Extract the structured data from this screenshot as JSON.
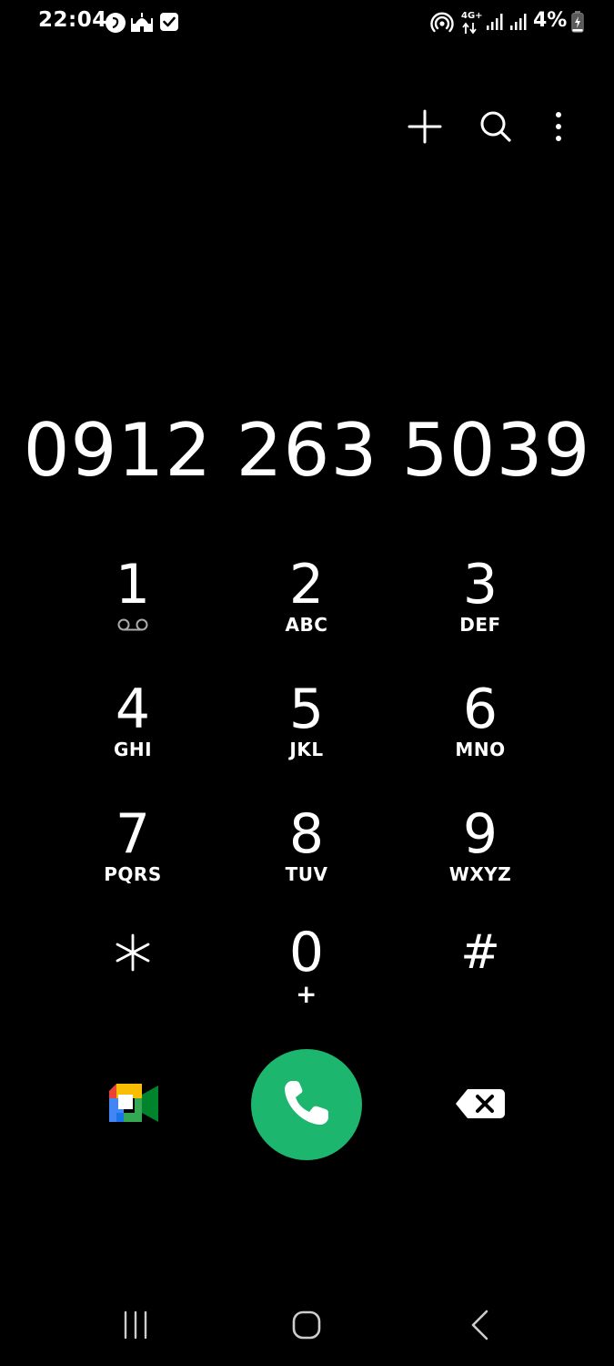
{
  "status_bar": {
    "time": "22:04",
    "network_label": "4G+",
    "battery_percent": "4%",
    "icons": [
      "calling-app-notification-icon",
      "mosque-notification-icon",
      "checkbox-notification-icon",
      "hotspot-icon",
      "network-4g-icon",
      "signal-icon",
      "signal-icon",
      "battery-charging-icon"
    ]
  },
  "toolbar": {
    "icons": [
      "plus-icon",
      "search-icon",
      "more-vertical-icon"
    ]
  },
  "dialer": {
    "number": "0912 263 5039"
  },
  "keypad": {
    "keys": [
      {
        "digit": "1",
        "letters": "",
        "sub_icon": "voicemail-icon"
      },
      {
        "digit": "2",
        "letters": "ABC"
      },
      {
        "digit": "3",
        "letters": "DEF"
      },
      {
        "digit": "4",
        "letters": "GHI"
      },
      {
        "digit": "5",
        "letters": "JKL"
      },
      {
        "digit": "6",
        "letters": "MNO"
      },
      {
        "digit": "7",
        "letters": "PQRS"
      },
      {
        "digit": "8",
        "letters": "TUV"
      },
      {
        "digit": "9",
        "letters": "WXYZ"
      },
      {
        "digit": "*",
        "letters": ""
      },
      {
        "digit": "0",
        "letters": "+"
      },
      {
        "digit": "#",
        "letters": ""
      }
    ]
  },
  "actions": {
    "icons": [
      "google-meet-icon",
      "phone-icon",
      "backspace-icon"
    ]
  },
  "navigation": {
    "icons": [
      "recent-apps-icon",
      "home-icon",
      "back-icon"
    ]
  },
  "colors": {
    "background": "#000000",
    "foreground": "#ffffff",
    "call_button": "#1db66e",
    "voicemail_icon": "#aaaaaa"
  }
}
